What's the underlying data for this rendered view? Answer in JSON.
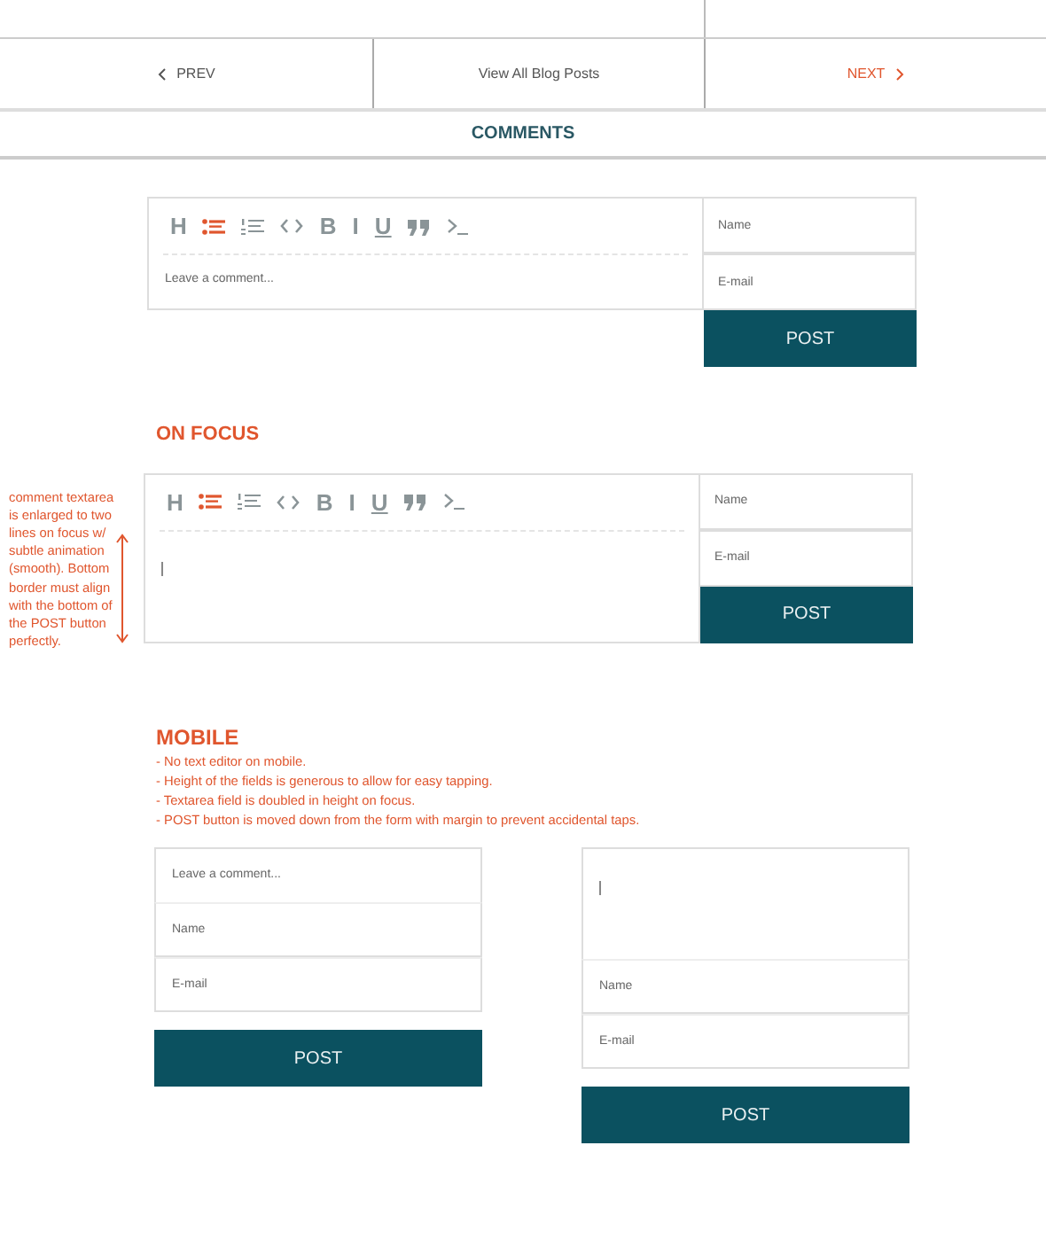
{
  "nav": {
    "items": [
      {
        "kind": "prev",
        "label": "PREV",
        "highlighted": false
      },
      {
        "kind": "all",
        "label": "View All Blog Posts",
        "highlighted": false
      },
      {
        "kind": "next",
        "label": "NEXT",
        "highlighted": true
      }
    ]
  },
  "comments_title": "COMMENTS",
  "editor": {
    "toolbar": [
      {
        "kind": "heading",
        "label": "H",
        "active": false
      },
      {
        "kind": "bullet-list",
        "active": true
      },
      {
        "kind": "numbered-list",
        "active": false
      },
      {
        "kind": "code",
        "active": false
      },
      {
        "kind": "bold",
        "label": "B",
        "active": false
      },
      {
        "kind": "italic",
        "label": "I",
        "active": false
      },
      {
        "kind": "underline",
        "label": "U",
        "active": false
      },
      {
        "kind": "quote",
        "active": false
      },
      {
        "kind": "terminal",
        "active": false
      }
    ],
    "comment": {
      "placeholder": "Leave a comment..."
    },
    "name": {
      "placeholder": "Name"
    },
    "email": {
      "placeholder": "E-mail"
    },
    "button": "POST",
    "focused": false
  },
  "focus_section": {
    "title": "ON FOCUS",
    "annotation": "comment textarea is enlarged to two lines on focus w/ subtle animation (smooth). Bottom border must align with the bottom of the POST button perfectly.",
    "editor": {
      "toolbar": [
        {
          "kind": "heading",
          "label": "H",
          "active": false
        },
        {
          "kind": "bullet-list",
          "active": true
        },
        {
          "kind": "numbered-list",
          "active": false
        },
        {
          "kind": "code",
          "active": false
        },
        {
          "kind": "bold",
          "label": "B",
          "active": false
        },
        {
          "kind": "italic",
          "label": "I",
          "active": false
        },
        {
          "kind": "underline",
          "label": "U",
          "active": false
        },
        {
          "kind": "quote",
          "active": false
        },
        {
          "kind": "terminal",
          "active": false
        }
      ],
      "name": {
        "placeholder": "Name"
      },
      "email": {
        "placeholder": "E-mail"
      },
      "button": "POST",
      "focused": true
    }
  },
  "mobile": {
    "title": "MOBILE",
    "notes": [
      "- No text editor on mobile.",
      "- Height of the fields is generous to allow for easy tapping.",
      "- Textarea field is doubled in height on focus.",
      "- POST button is moved down from the form with margin to prevent accidental taps."
    ],
    "forms": [
      {
        "focused": false,
        "comment": {
          "placeholder": "Leave a comment..."
        },
        "name": {
          "placeholder": "Name"
        },
        "email": {
          "placeholder": "E-mail"
        },
        "button": "POST"
      },
      {
        "focused": true,
        "name": {
          "placeholder": "Name"
        },
        "email": {
          "placeholder": "E-mail"
        },
        "button": "POST"
      }
    ]
  }
}
